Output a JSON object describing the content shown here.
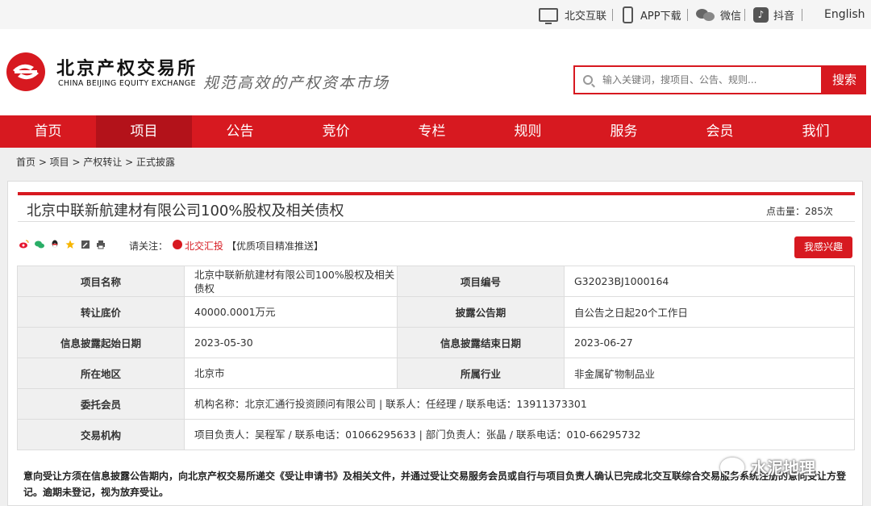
{
  "topbar": {
    "items": [
      {
        "label": "北交互联",
        "icon": "monitor-icon"
      },
      {
        "label": "APP下载",
        "icon": "phone-icon"
      },
      {
        "label": "微信",
        "icon": "wechat-icon"
      },
      {
        "label": "抖音",
        "icon": "tiktok-icon"
      }
    ],
    "lang": "English"
  },
  "header": {
    "logo_cn": "北京产权交易所",
    "logo_en": "CHINA BEIJING EQUITY EXCHANGE",
    "slogan": "规范高效的产权资本市场",
    "search_placeholder": "输入关键词，搜项目、公告、规则...",
    "search_button": "搜索"
  },
  "nav": {
    "items": [
      "首页",
      "项目",
      "公告",
      "竞价",
      "专栏",
      "规则",
      "服务",
      "会员",
      "我们"
    ],
    "active_index": 1
  },
  "breadcrumb": "首页 > 项目 > 产权转让 > 正式披露",
  "project": {
    "title": "北京中联新航建材有限公司100%股权及相关债权",
    "hits": "点击量：285次",
    "follow_label": "请关注：",
    "follow_name": "北交汇投",
    "follow_tag": "【优质项目精准推送】",
    "interest_button": "我感兴趣"
  },
  "table": {
    "row1": {
      "l1": "项目名称",
      "v1": "北京中联新航建材有限公司100%股权及相关债权",
      "l2": "项目编号",
      "v2": "G32023BJ1000164"
    },
    "row2": {
      "l1": "转让底价",
      "v1": "40000.0001万元",
      "l2": "披露公告期",
      "v2": "自公告之日起20个工作日"
    },
    "row3": {
      "l1": "信息披露起始日期",
      "v1": "2023-05-30",
      "l2": "信息披露结束日期",
      "v2": "2023-06-27"
    },
    "row4": {
      "l1": "所在地区",
      "v1": "北京市",
      "l2": "所属行业",
      "v2": "非金属矿物制品业"
    },
    "row5": {
      "l1": "委托会员",
      "v1": "机构名称：北京汇通行投资顾问有限公司 | 联系人：任经理 / 联系电话：13911373301"
    },
    "row6": {
      "l1": "交易机构",
      "v1": "项目负责人：吴程军 / 联系电话：01066295633 | 部门负责人：张晶 / 联系电话：010-66295732"
    }
  },
  "notice": "意向受让方须在信息披露公告期内，向北京产权交易所递交《受让申请书》及相关文件，并通过受让交易服务会员或自行与项目负责人确认已完成北交互联综合交易服务系统注册的意向受让方登记。逾期未登记，视为放弃受让。",
  "watermark": "水泥地理",
  "colors": {
    "brand": "#d71920",
    "nav_active": "#b3121a"
  }
}
